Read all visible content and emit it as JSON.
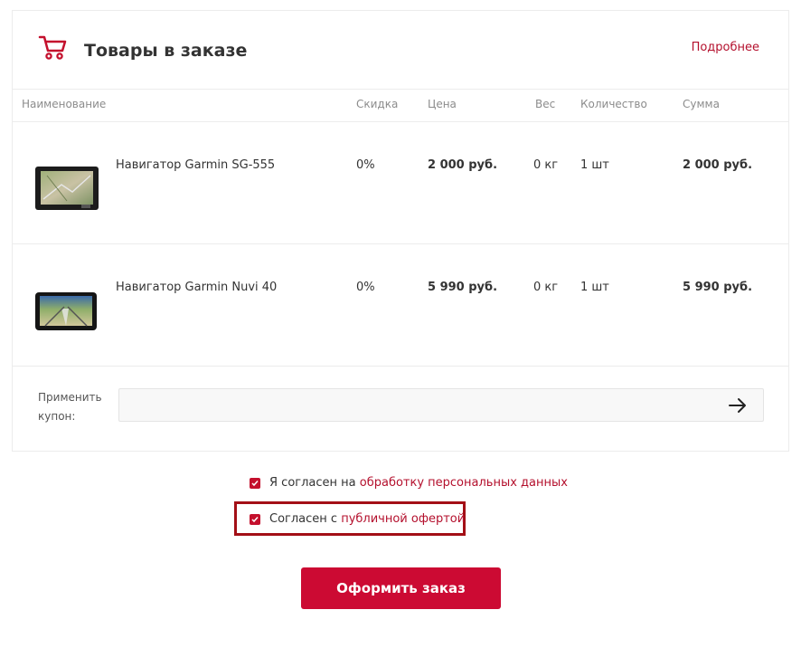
{
  "header": {
    "title": "Товары в заказе",
    "more_link": "Подробнее"
  },
  "table": {
    "columns": [
      "Наименование",
      "Скидка",
      "Цена",
      "Вес",
      "Количество",
      "Сумма"
    ],
    "rows": [
      {
        "name": "Навигатор Garmin SG-555",
        "discount": "0%",
        "price": "2 000 руб.",
        "weight": "0 кг",
        "quantity": "1 шт",
        "sum": "2 000 руб."
      },
      {
        "name": "Навигатор Garmin Nuvi 40",
        "discount": "0%",
        "price": "5 990 руб.",
        "weight": "0 кг",
        "quantity": "1 шт",
        "sum": "5 990 руб."
      }
    ]
  },
  "coupon": {
    "label": "Применить купон:",
    "value": "",
    "placeholder": ""
  },
  "agreements": [
    {
      "text": "Я согласен на ",
      "link": "обработку персональных данных",
      "checked": true
    },
    {
      "text": "Согласен с ",
      "link": "публичной офертой",
      "checked": true
    }
  ],
  "submit_label": "Оформить заказ",
  "colors": {
    "accent": "#cc0a33",
    "link": "#b4102d",
    "highlight_border": "#a30f16"
  },
  "icons": {
    "cart": "cart-icon",
    "coupon_submit": "arrow-right-icon",
    "checkbox": "checkmark-icon"
  }
}
